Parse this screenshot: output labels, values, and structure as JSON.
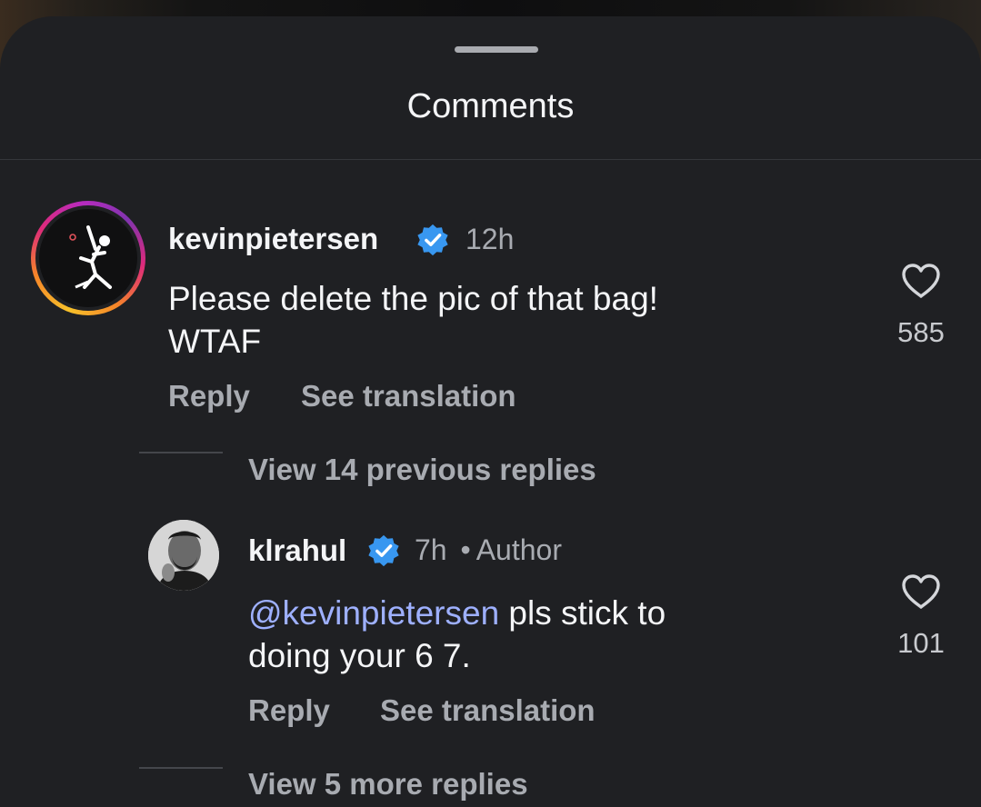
{
  "sheet": {
    "title": "Comments"
  },
  "comment": {
    "username": "kevinpietersen",
    "time": "12h",
    "text_line1": "Please delete the pic of that bag!",
    "text_line2": "WTAF",
    "like_count": "585",
    "reply_label": "Reply",
    "translate_label": "See translation",
    "view_replies_label": "View 14 previous replies"
  },
  "reply": {
    "username": "klrahul",
    "time": "7h",
    "separator": "•",
    "author_tag": "Author",
    "mention": "@kevinpietersen",
    "text_after_mention": " pls stick to",
    "text_line2": "doing your 6 7.",
    "like_count": "101",
    "reply_label": "Reply",
    "translate_label": "See translation",
    "more_replies_label": "View 5 more replies"
  },
  "icons": {
    "verified": "verified-badge-icon",
    "like": "heart-outline-icon",
    "handle": "drag-handle"
  },
  "colors": {
    "sheet_background": "#1f2023",
    "verified_blue": "#3897f0",
    "mention_blue": "#9eb0ff",
    "secondary_text": "#a8abb1"
  }
}
